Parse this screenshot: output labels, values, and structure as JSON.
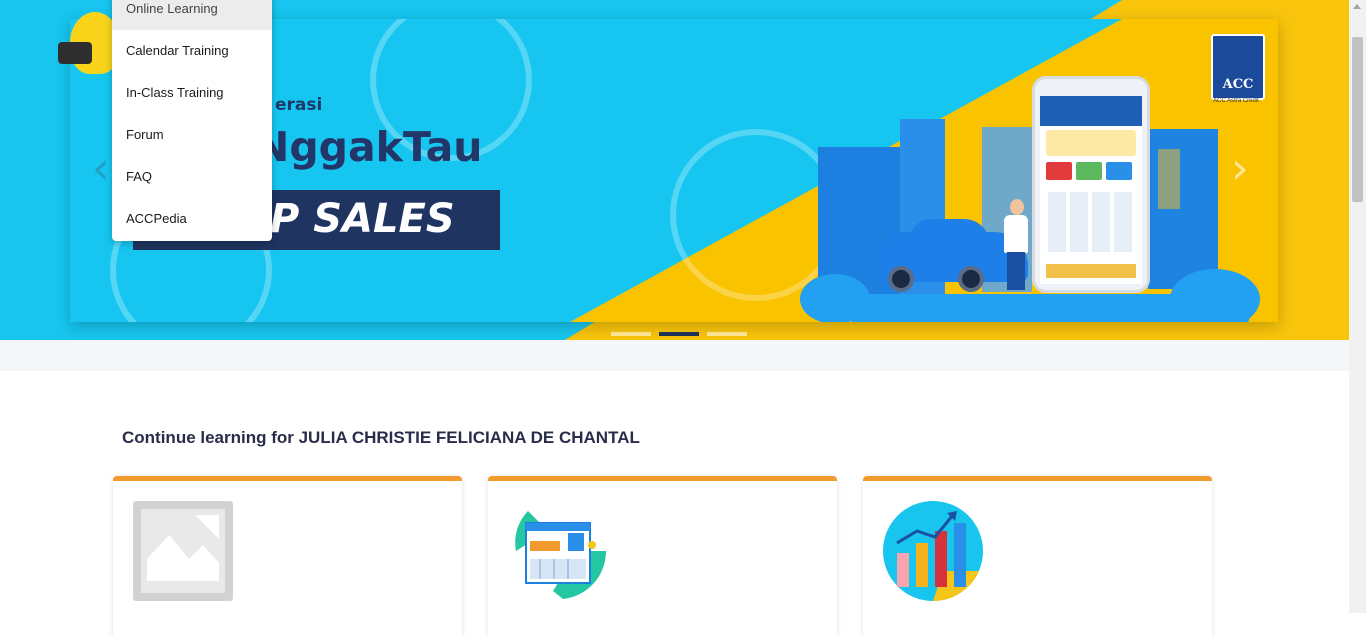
{
  "menu": {
    "items": [
      {
        "label": "Online Learning"
      },
      {
        "label": "Calendar Training"
      },
      {
        "label": "In-Class Training"
      },
      {
        "label": "Forum"
      },
      {
        "label": "FAQ"
      },
      {
        "label": "ACCPedia"
      }
    ]
  },
  "banner": {
    "subtitle": "erasi",
    "hashtag": "NggakTau",
    "band_text": "P SALES",
    "logo_text": "ACC",
    "logo_caption": "ACC Astra Credit",
    "prev_arrow": "‹",
    "next_arrow": "›",
    "active_slide": 2,
    "slide_count": 3
  },
  "section": {
    "title": "Continue learning for JULIA CHRISTIE FELICIANA DE CHANTAL"
  },
  "colors": {
    "banner_blue": "#17c5ef",
    "banner_yellow": "#f8c40c",
    "card_accent": "#f29a2e",
    "title_text": "#2a2d4a"
  },
  "cards": [
    {
      "icon": "image-placeholder-icon"
    },
    {
      "icon": "building-icon"
    },
    {
      "icon": "bar-chart-growth-icon"
    }
  ]
}
